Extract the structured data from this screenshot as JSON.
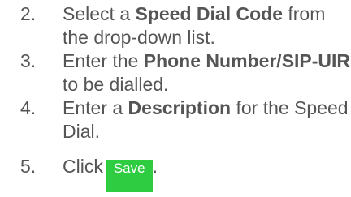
{
  "steps": [
    {
      "num": "2.",
      "before": "Select a ",
      "bold": "Speed Dial Code",
      "after": " from the drop-down list."
    },
    {
      "num": "3.",
      "before": "Enter the ",
      "bold": "Phone Number/SIP-UIR",
      "after": " to be dialled."
    },
    {
      "num": "4.",
      "before": "Enter a ",
      "bold": "Description",
      "after": " for the Speed Dial."
    }
  ],
  "last_step": {
    "num": "5.",
    "text": "Click",
    "button_label": "Save",
    "end": "."
  },
  "colors": {
    "text": "#555555",
    "save_button": "#2ecc40"
  }
}
